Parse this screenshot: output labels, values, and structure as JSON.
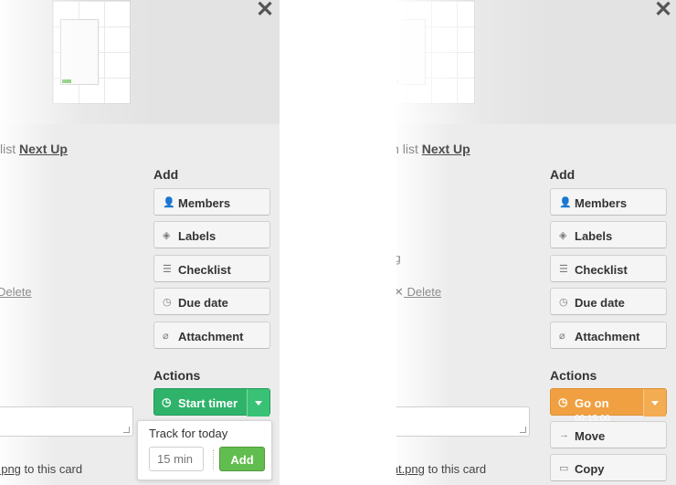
{
  "left": {
    "list_prefix": "list",
    "list_name": "Next Up",
    "delete_label": "Delete",
    "attach_file": "t.png",
    "attach_suffix": " to this card",
    "add_heading": "Add",
    "add_buttons": [
      {
        "label": "Members",
        "icon": "person-icon"
      },
      {
        "label": "Labels",
        "icon": "tag-icon"
      },
      {
        "label": "Checklist",
        "icon": "list-icon"
      },
      {
        "label": "Due date",
        "icon": "clock-icon"
      },
      {
        "label": "Attachment",
        "icon": "paperclip-icon"
      }
    ],
    "actions_heading": "Actions",
    "timer_label": "Start timer",
    "popover": {
      "title": "Track for today",
      "input_placeholder": "15 min",
      "add_label": "Add"
    }
  },
  "right": {
    "list_prefix": "in list",
    "list_name": "Next Up",
    "attach_name": "png",
    "delete_label": "Delete",
    "attach_file": "vent.png",
    "attach_suffix": " to this card",
    "add_heading": "Add",
    "add_buttons": [
      {
        "label": "Members",
        "icon": "person-icon"
      },
      {
        "label": "Labels",
        "icon": "tag-icon"
      },
      {
        "label": "Checklist",
        "icon": "list-icon"
      },
      {
        "label": "Due date",
        "icon": "clock-icon"
      },
      {
        "label": "Attachment",
        "icon": "paperclip-icon"
      }
    ],
    "actions_heading": "Actions",
    "timer_label": "Go on",
    "timer_time": "00:15:00",
    "action_buttons": [
      {
        "label": "Move",
        "icon": "arrow-right-icon"
      },
      {
        "label": "Copy",
        "icon": "copy-icon"
      }
    ]
  },
  "colors": {
    "timer_green": "#2fb36a",
    "timer_orange": "#f0a041",
    "add_green": "#61bd4f"
  }
}
